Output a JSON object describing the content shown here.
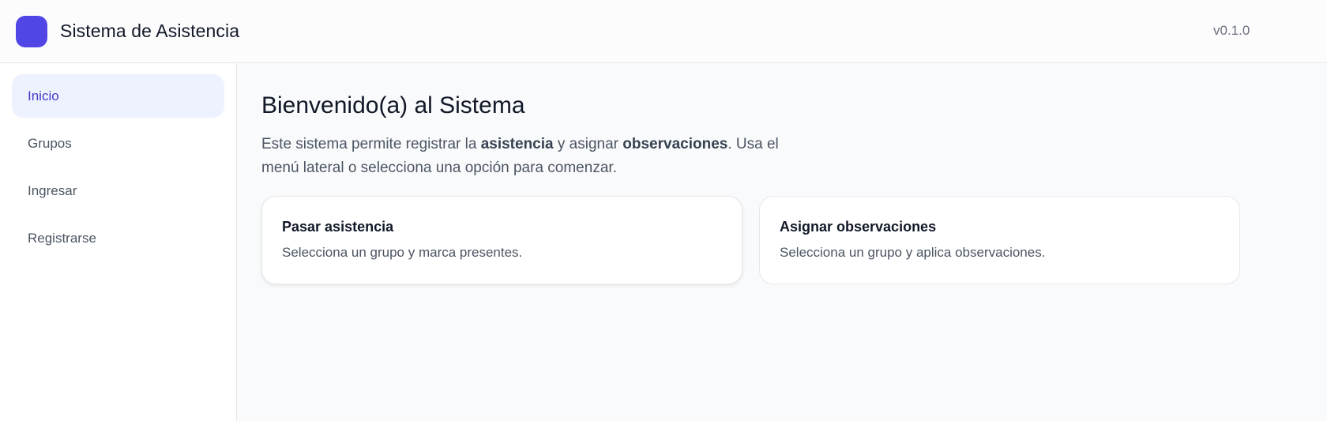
{
  "header": {
    "title": "Sistema de Asistencia",
    "version": "v0.1.0",
    "logo_color": "#4f46e5"
  },
  "sidebar": {
    "items": [
      {
        "label": "Inicio",
        "active": true
      },
      {
        "label": "Grupos",
        "active": false
      },
      {
        "label": "Ingresar",
        "active": false
      },
      {
        "label": "Registrarse",
        "active": false
      }
    ]
  },
  "main": {
    "title": "Bienvenido(a) al Sistema",
    "intro": {
      "part1": "Este sistema permite registrar la ",
      "bold1": "asistencia",
      "part2": " y asignar ",
      "bold2": "observaciones",
      "part3": ". Usa el menú lateral o selecciona una opción para comenzar."
    },
    "cards": [
      {
        "title": "Pasar asistencia",
        "description": "Selecciona un grupo y marca presentes."
      },
      {
        "title": "Asignar observaciones",
        "description": "Selecciona un grupo y aplica observaciones."
      }
    ]
  }
}
